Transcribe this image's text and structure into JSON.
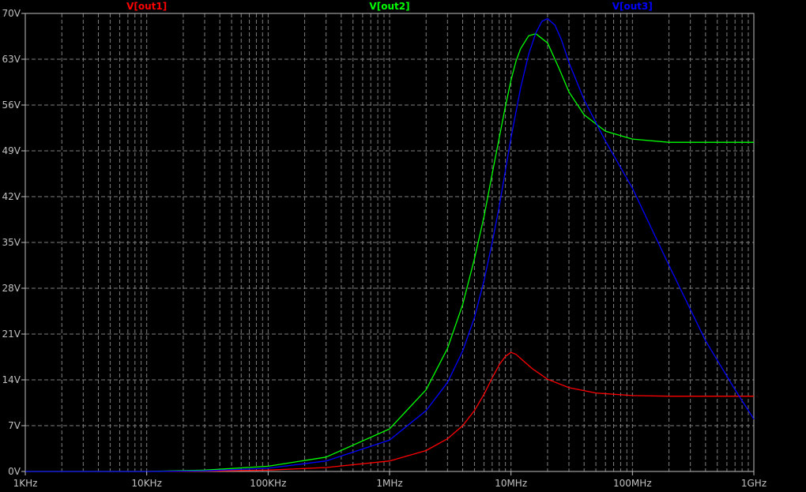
{
  "chart_data": {
    "type": "line",
    "x_scale": "log",
    "xlim": [
      1000,
      1000000000
    ],
    "ylim": [
      0,
      70
    ],
    "grid": true,
    "x_ticks": [
      {
        "value": 1000,
        "label": "1KHz"
      },
      {
        "value": 10000,
        "label": "10KHz"
      },
      {
        "value": 100000,
        "label": "100KHz"
      },
      {
        "value": 1000000,
        "label": "1MHz"
      },
      {
        "value": 10000000,
        "label": "10MHz"
      },
      {
        "value": 100000000,
        "label": "100MHz"
      },
      {
        "value": 1000000000,
        "label": "1GHz"
      }
    ],
    "y_ticks": [
      {
        "value": 0,
        "label": "0V"
      },
      {
        "value": 7,
        "label": "7V"
      },
      {
        "value": 14,
        "label": "14V"
      },
      {
        "value": 21,
        "label": "21V"
      },
      {
        "value": 28,
        "label": "28V"
      },
      {
        "value": 35,
        "label": "35V"
      },
      {
        "value": 42,
        "label": "42V"
      },
      {
        "value": 49,
        "label": "49V"
      },
      {
        "value": 56,
        "label": "56V"
      },
      {
        "value": 63,
        "label": "63V"
      },
      {
        "value": 70,
        "label": "70V"
      }
    ],
    "series": [
      {
        "name": "V[out1]",
        "color": "#ff0000",
        "x": [
          1000,
          10000,
          30000,
          100000,
          300000,
          1000000,
          2000000,
          3000000,
          4000000,
          5000000,
          6000000,
          7000000,
          8000000,
          9000000,
          10000000,
          11000000,
          13000000,
          15000000,
          20000000,
          30000000,
          50000000,
          100000000,
          200000000,
          1000000000
        ],
        "y": [
          0,
          0,
          0.05,
          0.2,
          0.6,
          1.6,
          3.2,
          5.0,
          7.0,
          9.3,
          11.8,
          14.3,
          16.3,
          17.6,
          18.2,
          17.9,
          16.7,
          15.7,
          14.1,
          12.8,
          12.0,
          11.6,
          11.5,
          11.5
        ]
      },
      {
        "name": "V[out2]",
        "color": "#00ff00",
        "x": [
          1000,
          10000,
          30000,
          100000,
          300000,
          1000000,
          2000000,
          3000000,
          4000000,
          5000000,
          6000000,
          7000000,
          8000000,
          9000000,
          10000000,
          11000000,
          12000000,
          14000000,
          16000000,
          20000000,
          25000000,
          30000000,
          40000000,
          60000000,
          100000000,
          200000000,
          1000000000
        ],
        "y": [
          0,
          0,
          0.2,
          0.8,
          2.2,
          6.5,
          12.5,
          18.8,
          25.5,
          32.5,
          39.0,
          45.5,
          51.0,
          55.8,
          59.8,
          62.7,
          64.6,
          66.6,
          66.9,
          65.5,
          61.5,
          58.0,
          54.5,
          52.0,
          50.8,
          50.3,
          50.3
        ]
      },
      {
        "name": "V[out3]",
        "color": "#0000ff",
        "x": [
          1000,
          10000,
          30000,
          100000,
          300000,
          1000000,
          2000000,
          3000000,
          4000000,
          5000000,
          6000000,
          7000000,
          8000000,
          9000000,
          10000000,
          12000000,
          14000000,
          16000000,
          18000000,
          20000000,
          23000000,
          26000000,
          30000000,
          40000000,
          60000000,
          100000000,
          200000000,
          400000000,
          700000000,
          1000000000
        ],
        "y": [
          0,
          0,
          0.1,
          0.5,
          1.6,
          4.8,
          9.3,
          13.6,
          18.4,
          23.5,
          29.2,
          35.0,
          40.5,
          46.0,
          51.0,
          58.6,
          63.8,
          67.0,
          68.8,
          69.2,
          68.2,
          66.0,
          62.5,
          56.8,
          50.5,
          43.3,
          31.5,
          20.0,
          12.5,
          8.0
        ]
      }
    ]
  }
}
